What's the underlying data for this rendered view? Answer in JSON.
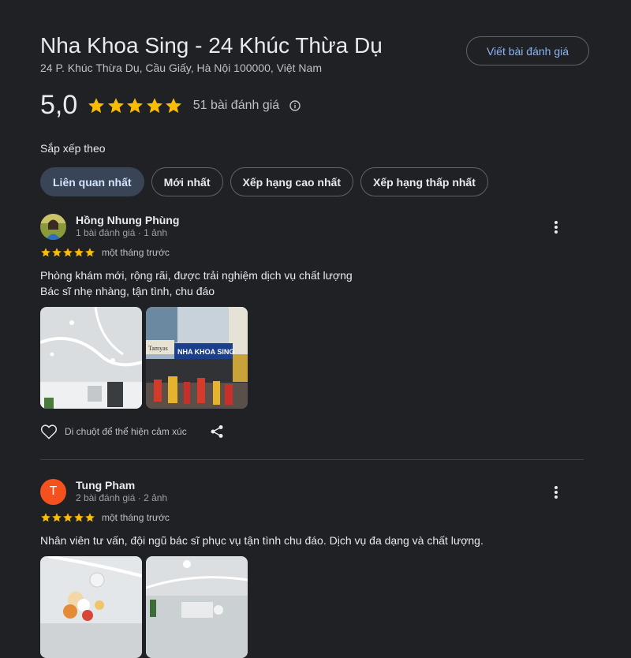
{
  "place": {
    "title": "Nha Khoa Sing - 24 Khúc Thừa Dụ",
    "address": "24 P. Khúc Thừa Dụ, Cầu Giấy, Hà Nội 100000, Việt Nam",
    "write_review_label": "Viết bài đánh giá",
    "rating": "5,0",
    "stars": 5,
    "review_count": "51 bài đánh giá"
  },
  "sort": {
    "label": "Sắp xếp theo",
    "options": [
      "Liên quan nhất",
      "Mới nhất",
      "Xếp hạng cao nhất",
      "Xếp hạng thấp nhất"
    ],
    "selected": "Liên quan nhất"
  },
  "reviews": [
    {
      "name": "Hồng Nhung Phùng",
      "meta": "1 bài đánh giá · 1 ảnh",
      "stars": 5,
      "time": "một tháng trước",
      "text_lines": [
        "Phòng khám mới, rộng rãi, được trải nghiệm dịch vụ chất lượng",
        "Bác sĩ nhẹ nhàng, tận tình, chu đáo"
      ],
      "photo_sign_text": "NHA KHOA SING",
      "photo_side_text": "Tamyas",
      "react_label": "Di chuột để thể hiện cảm xúc"
    },
    {
      "name": "Tung Pham",
      "avatar_letter": "T",
      "meta": "2 bài đánh giá · 2 ảnh",
      "stars": 5,
      "time": "một tháng trước",
      "text_lines": [
        "Nhân viên tư vấn, đội ngũ bác sĩ phục vụ tận tình chu đáo. Dịch vụ đa dạng và chất lượng."
      ]
    }
  ],
  "colors": {
    "background": "#202124",
    "star": "#fbbc04",
    "accent_link": "#8ab4f8",
    "active_chip": "#394457",
    "avatar_t": "#f4511e"
  }
}
